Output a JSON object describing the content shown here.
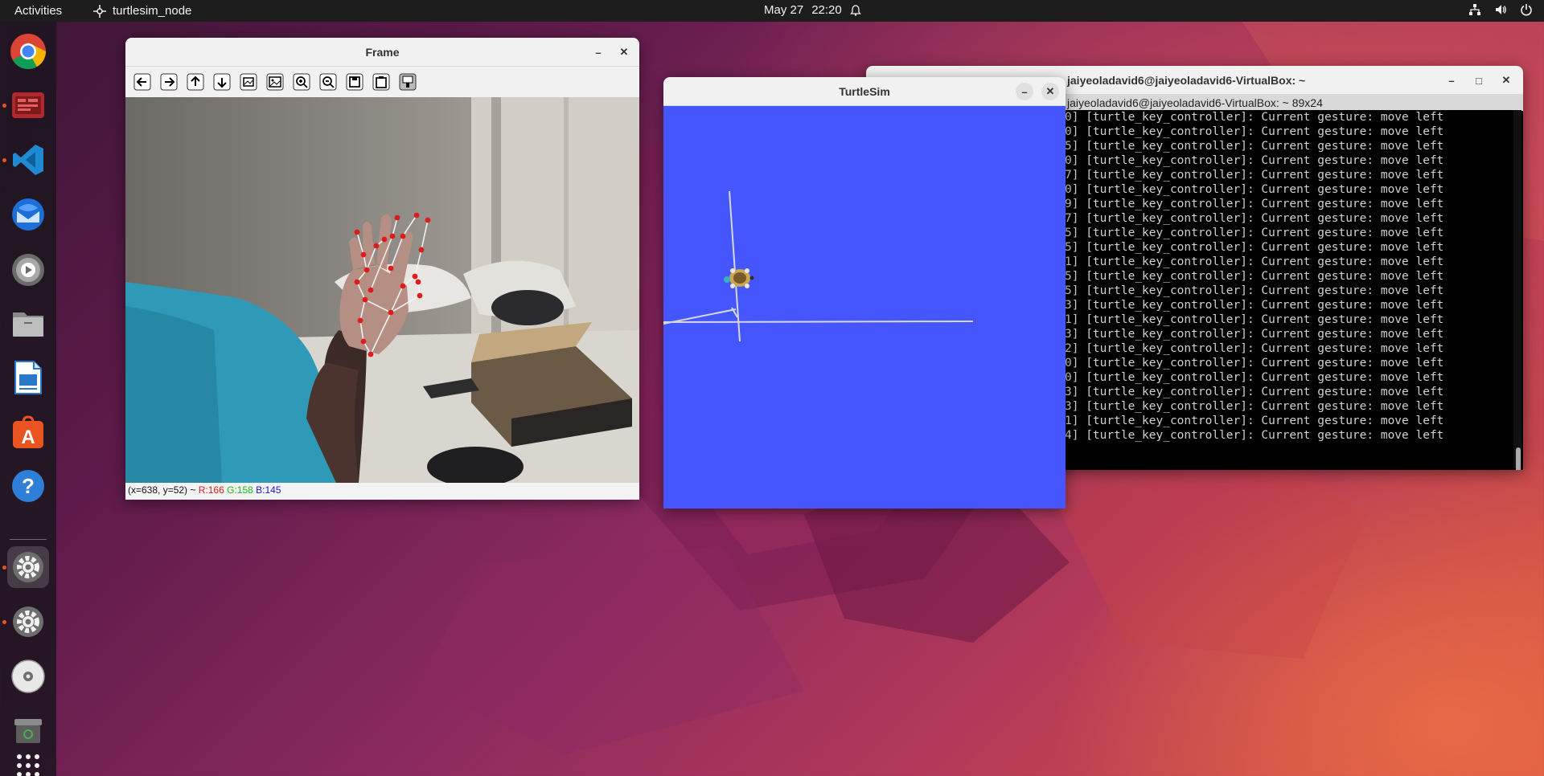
{
  "topbar": {
    "activities": "Activities",
    "app_name": "turtlesim_node",
    "date": "May 27",
    "time": "22:20"
  },
  "dock": {
    "items": [
      {
        "name": "chrome-icon"
      },
      {
        "name": "terminal-app-icon"
      },
      {
        "name": "vscode-icon"
      },
      {
        "name": "thunderbird-icon"
      },
      {
        "name": "rhythmbox-icon"
      },
      {
        "name": "files-icon"
      },
      {
        "name": "libreoffice-writer-icon"
      },
      {
        "name": "app-center-icon"
      },
      {
        "name": "help-icon"
      },
      {
        "name": "settings-icon"
      },
      {
        "name": "settings-icon-2"
      },
      {
        "name": "disc-icon"
      },
      {
        "name": "trash-icon"
      },
      {
        "name": "show-apps-icon"
      }
    ]
  },
  "frame_window": {
    "title": "Frame",
    "status": "(x=638, y=52) ~ ",
    "r": "R:166",
    "g": "G:158",
    "b": "B:145"
  },
  "turtlesim_window": {
    "title": "TurtleSim",
    "bg_color": "#4556ff"
  },
  "terminal_window": {
    "title": "jaiyeoladavid6@jaiyeoladavid6-VirtualBox: ~",
    "tab_title": "jaiyeoladavid6@jaiyeoladavid6-VirtualBox: ~ 89x24",
    "lines": [
      "0] [turtle_key_controller]: Current gesture: move left",
      "0] [turtle_key_controller]: Current gesture: move left",
      "5] [turtle_key_controller]: Current gesture: move left",
      "0] [turtle_key_controller]: Current gesture: move left",
      "7] [turtle_key_controller]: Current gesture: move left",
      "0] [turtle_key_controller]: Current gesture: move left",
      "9] [turtle_key_controller]: Current gesture: move left",
      "7] [turtle_key_controller]: Current gesture: move left",
      "5] [turtle_key_controller]: Current gesture: move left",
      "5] [turtle_key_controller]: Current gesture: move left",
      "1] [turtle_key_controller]: Current gesture: move left",
      "5] [turtle_key_controller]: Current gesture: move left",
      "5] [turtle_key_controller]: Current gesture: move left",
      "3] [turtle_key_controller]: Current gesture: move left",
      "1] [turtle_key_controller]: Current gesture: move left",
      "3] [turtle_key_controller]: Current gesture: move left",
      "2] [turtle_key_controller]: Current gesture: move left",
      "0] [turtle_key_controller]: Current gesture: move left",
      "0] [turtle_key_controller]: Current gesture: move left",
      "3] [turtle_key_controller]: Current gesture: move left",
      "3] [turtle_key_controller]: Current gesture: move left",
      "1] [turtle_key_controller]: Current gesture: move left",
      "4] [turtle_key_controller]: Current gesture: move left"
    ]
  },
  "colors": {
    "accent": "#e95420",
    "topbar": "#1d1d1d"
  }
}
